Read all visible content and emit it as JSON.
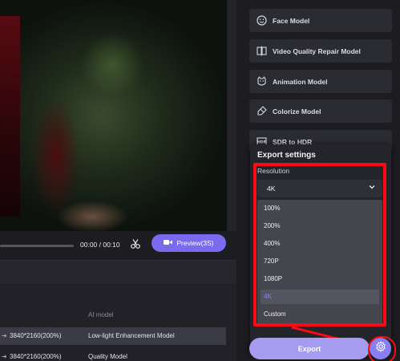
{
  "player": {
    "time": "00:00 / 00:10",
    "preview_label": "Preview(3S)"
  },
  "table": {
    "ai_model_header": "AI model",
    "rows": [
      {
        "resolution": "3840*2160(200%)",
        "model": "Low-light Enhancement Model"
      },
      {
        "resolution": "3840*2160(200%)",
        "model": "Quality Model"
      }
    ]
  },
  "models": [
    {
      "label": "Face Model",
      "icon": "face-icon"
    },
    {
      "label": "Video Quality Repair Model",
      "icon": "video-repair-icon"
    },
    {
      "label": "Animation Model",
      "icon": "animation-icon"
    },
    {
      "label": "Colorize Model",
      "icon": "colorize-icon"
    },
    {
      "label": "SDR to HDR",
      "icon": "hdr-icon"
    }
  ],
  "export_settings": {
    "title": "Export settings",
    "resolution_label": "Resolution",
    "selected": "4K",
    "options": [
      "100%",
      "200%",
      "400%",
      "720P",
      "1080P",
      "4K",
      "Custom"
    ]
  },
  "footer": {
    "export_label": "Export"
  },
  "colors": {
    "accent": "#7a6af0",
    "highlight": "#ff0a14"
  }
}
